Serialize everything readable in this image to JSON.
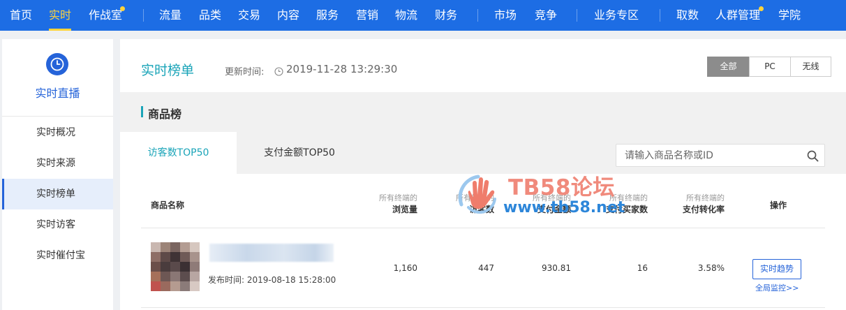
{
  "topnav": {
    "items": [
      {
        "label": "首页",
        "active": false,
        "dot": false
      },
      {
        "label": "实时",
        "active": true,
        "dot": false
      },
      {
        "label": "作战室",
        "active": false,
        "dot": true
      },
      {
        "label": "流量",
        "active": false,
        "dot": false
      },
      {
        "label": "品类",
        "active": false,
        "dot": false
      },
      {
        "label": "交易",
        "active": false,
        "dot": false
      },
      {
        "label": "内容",
        "active": false,
        "dot": false
      },
      {
        "label": "服务",
        "active": false,
        "dot": false
      },
      {
        "label": "营销",
        "active": false,
        "dot": false
      },
      {
        "label": "物流",
        "active": false,
        "dot": false
      },
      {
        "label": "财务",
        "active": false,
        "dot": false
      },
      {
        "label": "市场",
        "active": false,
        "dot": false
      },
      {
        "label": "竞争",
        "active": false,
        "dot": false
      },
      {
        "label": "业务专区",
        "active": false,
        "dot": false
      },
      {
        "label": "取数",
        "active": false,
        "dot": false
      },
      {
        "label": "人群管理",
        "active": false,
        "dot": true
      },
      {
        "label": "学院",
        "active": false,
        "dot": false
      }
    ]
  },
  "sidebar": {
    "icon": "clock-icon",
    "title": "实时直播",
    "items": [
      {
        "label": "实时概况",
        "active": false
      },
      {
        "label": "实时来源",
        "active": false
      },
      {
        "label": "实时榜单",
        "active": true
      },
      {
        "label": "实时访客",
        "active": false
      },
      {
        "label": "实时催付宝",
        "active": false
      }
    ]
  },
  "header": {
    "title": "实时榜单",
    "update_label": "更新时间:",
    "update_time": "2019-11-28 13:29:30",
    "device_filter": [
      {
        "label": "全部",
        "active": true
      },
      {
        "label": "PC",
        "active": false
      },
      {
        "label": "无线",
        "active": false
      }
    ]
  },
  "section": {
    "title": "商品榜"
  },
  "tabs": [
    {
      "label": "访客数TOP50",
      "active": true
    },
    {
      "label": "支付金额TOP50",
      "active": false
    }
  ],
  "search": {
    "placeholder": "请输入商品名称或ID",
    "value": ""
  },
  "table": {
    "name_header": "商品名称",
    "columns": [
      {
        "top": "所有终端的",
        "main": "浏览量"
      },
      {
        "top": "所有终端的",
        "main": "访客数"
      },
      {
        "top": "所有终端的",
        "main": "支付金额"
      },
      {
        "top": "所有终端的",
        "main": "支付买家数"
      },
      {
        "top": "所有终端的",
        "main": "支付转化率"
      }
    ],
    "op_header": "操作",
    "rows": [
      {
        "publish_time": "发布时间: 2019-08-18 15:28:00",
        "values": [
          "1,160",
          "447",
          "930.81",
          "16",
          "3.58%"
        ],
        "action": "实时趋势",
        "link": "全局监控>>"
      }
    ]
  },
  "watermark": {
    "title": "TB58论坛",
    "url": "www.tb58.net"
  },
  "colors": {
    "nav_bg": "#1d6de4",
    "nav_active": "#ffd43b",
    "accent_teal": "#1aa4b8",
    "accent_blue": "#2563d9"
  }
}
